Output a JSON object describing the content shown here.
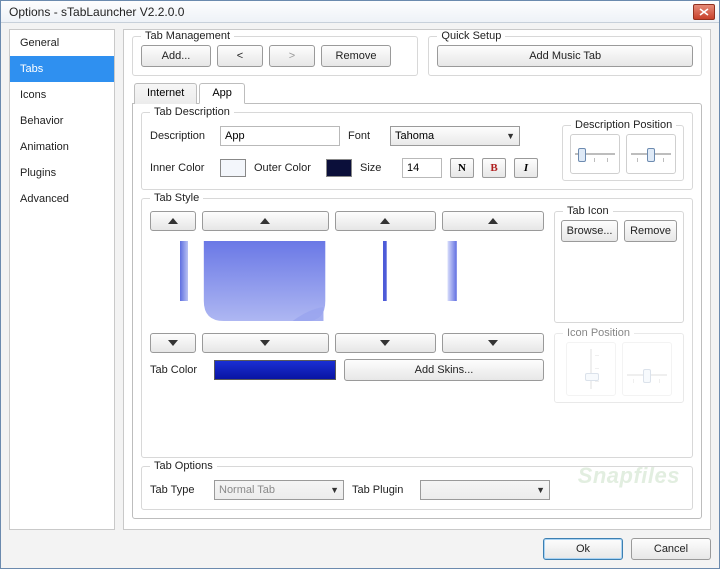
{
  "window": {
    "title": "Options - sTabLauncher V2.2.0.0"
  },
  "sidebar": {
    "items": [
      {
        "label": "General"
      },
      {
        "label": "Tabs",
        "selected": true
      },
      {
        "label": "Icons"
      },
      {
        "label": "Behavior"
      },
      {
        "label": "Animation"
      },
      {
        "label": "Plugins"
      },
      {
        "label": "Advanced"
      }
    ]
  },
  "tab_mgmt": {
    "title": "Tab Management",
    "add": "Add...",
    "prev": "<",
    "next": ">",
    "remove": "Remove"
  },
  "quick": {
    "title": "Quick Setup",
    "add_music": "Add Music Tab"
  },
  "inner_tabs": {
    "internet": "Internet",
    "app": "App"
  },
  "desc": {
    "title": "Tab Description",
    "description_label": "Description",
    "description_value": "App",
    "font_label": "Font",
    "font_value": "Tahoma",
    "inner_color_label": "Inner Color",
    "inner_color": "#f3f6fb",
    "outer_color_label": "Outer Color",
    "outer_color": "#0b0f3a",
    "size_label": "Size",
    "size_value": "14",
    "style_normal": "N",
    "style_bold": "B",
    "style_italic": "I",
    "pos_title": "Description Position"
  },
  "style": {
    "title": "Tab Style",
    "tab_color_label": "Tab Color",
    "tab_color": "#1220c4",
    "add_skins": "Add Skins...",
    "icon_title": "Tab Icon",
    "browse": "Browse...",
    "remove": "Remove",
    "icon_pos_title": "Icon Position"
  },
  "options": {
    "title": "Tab Options",
    "type_label": "Tab Type",
    "type_value": "Normal Tab",
    "plugin_label": "Tab Plugin",
    "plugin_value": ""
  },
  "footer": {
    "ok": "Ok",
    "cancel": "Cancel"
  },
  "watermark": "Snapfiles"
}
